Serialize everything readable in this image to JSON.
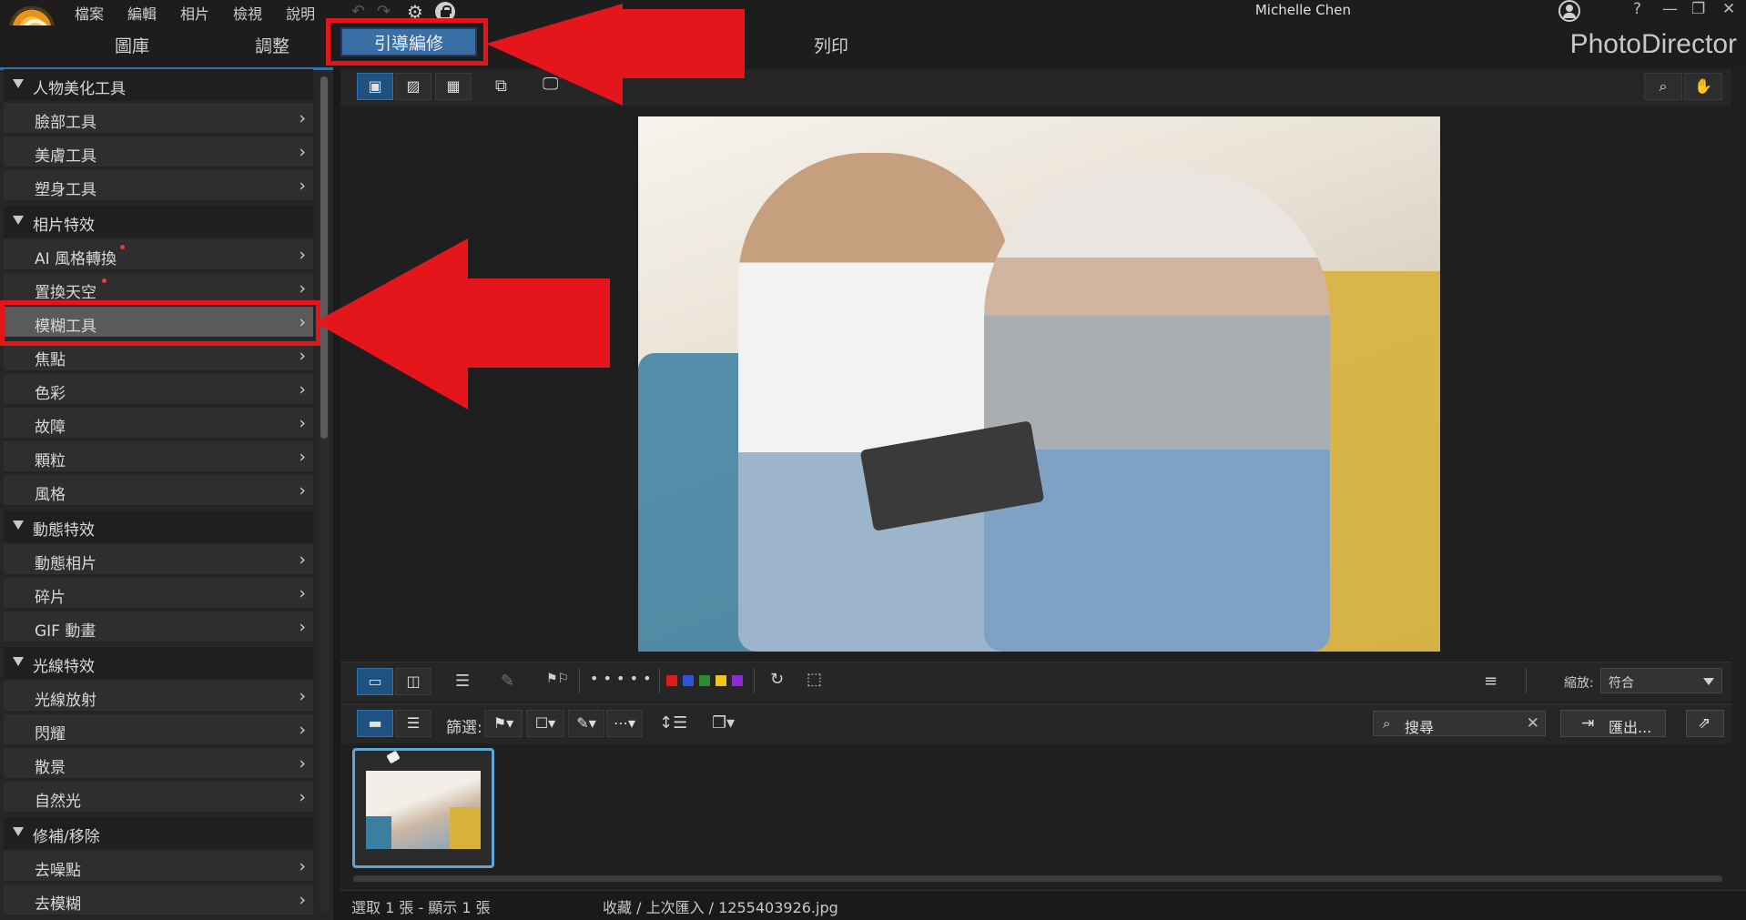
{
  "menu": [
    "檔案",
    "編輯",
    "相片",
    "檢視",
    "說明"
  ],
  "user": {
    "name": "Michelle Chen"
  },
  "window_controls": [
    "?",
    "—",
    "❐",
    "✕"
  ],
  "tabs": {
    "library": "圖庫",
    "adjust": "調整",
    "guided": "引導編修",
    "print": "列印"
  },
  "brand": "PhotoDirector",
  "left_panel": {
    "section1": {
      "title": "人物美化工具",
      "items": [
        "臉部工具",
        "美膚工具",
        "塑身工具"
      ]
    },
    "section2": {
      "title": "相片特效",
      "items": [
        "AI 風格轉換",
        "置換天空",
        "模糊工具",
        "焦點",
        "色彩",
        "故障",
        "顆粒",
        "風格"
      ]
    },
    "section3": {
      "title": "動態特效",
      "items": [
        "動態相片",
        "碎片",
        "GIF 動畫"
      ]
    },
    "section4": {
      "title": "光線特效",
      "items": [
        "光線放射",
        "閃耀",
        "散景",
        "自然光"
      ]
    },
    "section5": {
      "title": "修補/移除",
      "items": [
        "去噪點",
        "去模糊"
      ]
    },
    "selected_item": "模糊工具"
  },
  "toolbar": {
    "zoom_label": "縮放:",
    "zoom_value": "符合",
    "filter_label": "篩選:"
  },
  "search": {
    "placeholder": "搜尋"
  },
  "export_label": "匯出...",
  "label_colors": [
    "#e01b1b",
    "#2f53d6",
    "#2e8b2e",
    "#f1c419",
    "#8a2bd6"
  ],
  "rating_dots": "• • • • •",
  "status": {
    "selection": "選取 1 張 - 顯示 1 張",
    "path": "收藏 / 上次匯入 / 1255403926.jpg"
  },
  "accent_color": "#3a6fa5",
  "annotation_color": "#e5151c"
}
